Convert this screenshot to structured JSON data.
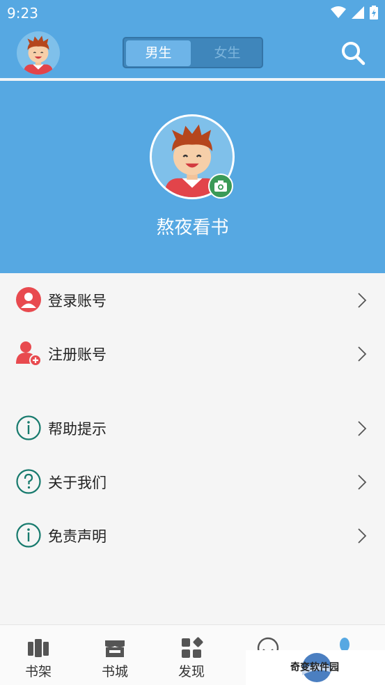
{
  "status_bar": {
    "time": "9:23"
  },
  "header": {
    "gender_tabs": [
      {
        "label": "男生",
        "active": true
      },
      {
        "label": "女生",
        "active": false
      }
    ]
  },
  "profile": {
    "name": "熬夜看书"
  },
  "menu": [
    {
      "label": "登录账号",
      "icon": "user-icon",
      "color": "#e84a4f"
    },
    {
      "label": "注册账号",
      "icon": "add-user-icon",
      "color": "#e84a4f"
    },
    {
      "label": "帮助提示",
      "icon": "info-icon",
      "color": "#177a6d"
    },
    {
      "label": "关于我们",
      "icon": "question-icon",
      "color": "#177a6d"
    },
    {
      "label": "免责声明",
      "icon": "info-icon",
      "color": "#177a6d"
    }
  ],
  "tabbar": [
    {
      "label": "书架",
      "icon": "bookshelf-icon"
    },
    {
      "label": "书城",
      "icon": "store-icon"
    },
    {
      "label": "发现",
      "icon": "discover-icon"
    },
    {
      "label": "",
      "icon": "smile-icon"
    },
    {
      "label": "",
      "icon": "mine-icon"
    }
  ],
  "watermark": {
    "text": "奇变软件园"
  },
  "colors": {
    "primary": "#56a8e2",
    "accent_red": "#e84a4f",
    "accent_teal": "#177a6d",
    "camera_green": "#3a9a57"
  }
}
